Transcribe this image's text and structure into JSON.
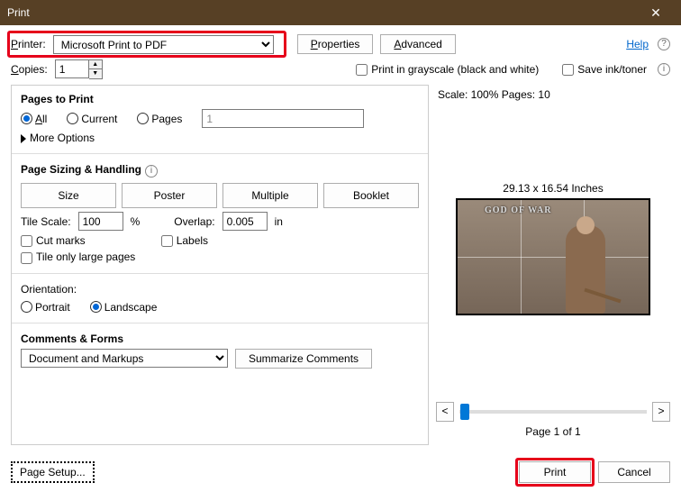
{
  "titlebar": {
    "title": "Print"
  },
  "printer": {
    "label": "Printer:",
    "selected": "Microsoft Print to PDF",
    "properties_btn": "Properties",
    "advanced_btn": "Advanced",
    "help": "Help"
  },
  "copies": {
    "label": "Copies:",
    "value": "1",
    "grayscale": "Print in grayscale (black and white)",
    "save_ink": "Save ink/toner"
  },
  "pages": {
    "title": "Pages to Print",
    "all": "All",
    "current": "Current",
    "pages": "Pages",
    "pages_value": "1",
    "more_options": "More Options"
  },
  "sizing": {
    "title": "Page Sizing & Handling",
    "size": "Size",
    "poster": "Poster",
    "multiple": "Multiple",
    "booklet": "Booklet",
    "tile_scale_label": "Tile Scale:",
    "tile_scale_value": "100",
    "tile_scale_unit": "%",
    "overlap_label": "Overlap:",
    "overlap_value": "0.005",
    "overlap_unit": "in",
    "cut_marks": "Cut marks",
    "labels": "Labels",
    "tile_large": "Tile only large pages"
  },
  "orientation": {
    "title": "Orientation:",
    "portrait": "Portrait",
    "landscape": "Landscape"
  },
  "forms": {
    "title": "Comments & Forms",
    "selected": "Document and Markups",
    "summarize": "Summarize Comments"
  },
  "preview": {
    "scale_pages": "Scale: 100% Pages: 10",
    "dimensions": "29.13 x 16.54 Inches",
    "logo": "GOD OF WAR",
    "page_of": "Page 1 of 1",
    "prev": "<",
    "next": ">"
  },
  "footer": {
    "page_setup": "Page Setup...",
    "print": "Print",
    "cancel": "Cancel"
  }
}
